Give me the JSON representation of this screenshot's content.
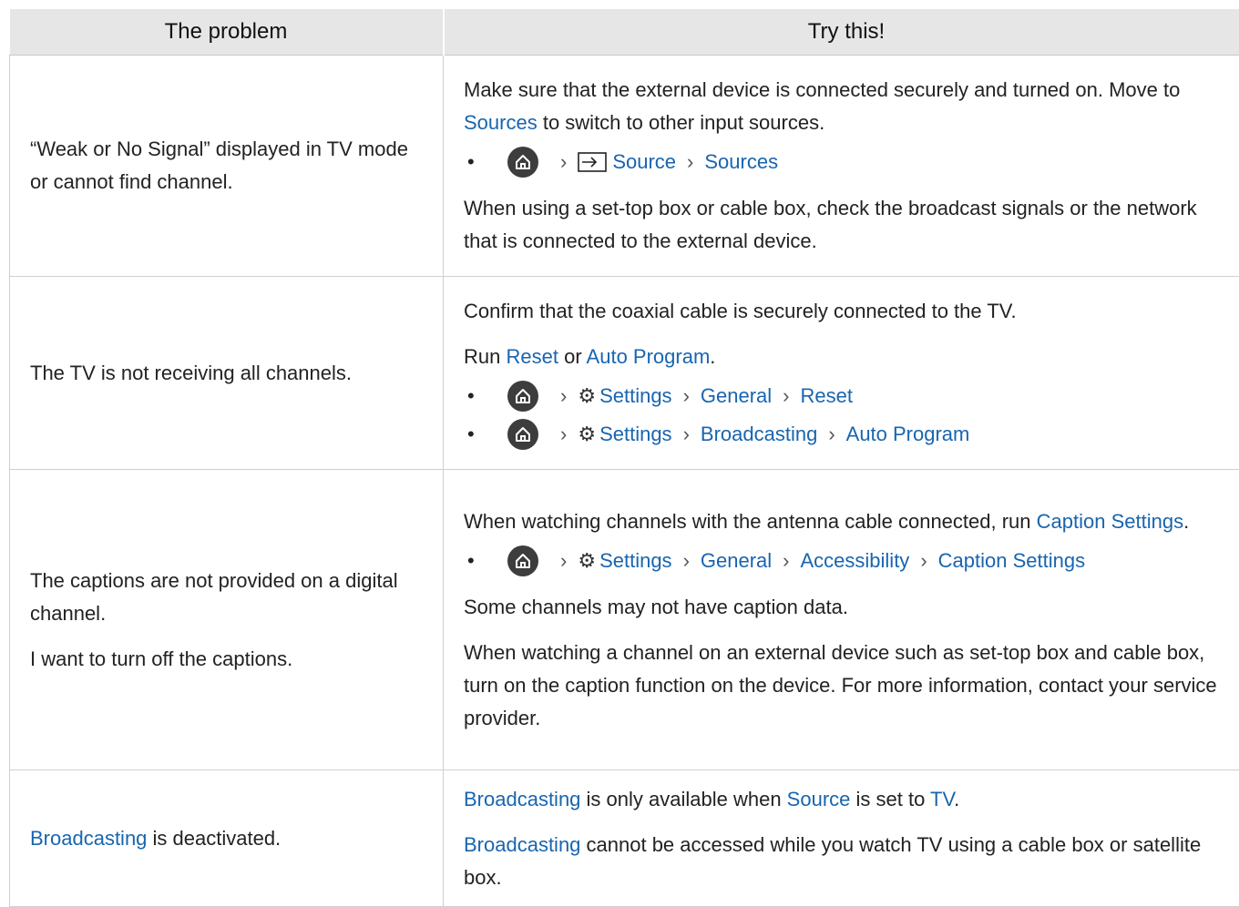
{
  "header": {
    "col1": "The problem",
    "col2": "Try this!"
  },
  "rows": [
    {
      "problem": [
        "“Weak or No Signal” displayed in TV mode or cannot find channel."
      ],
      "p1": {
        "t1": "Make sure that the external device is connected securely and turned on. Move to ",
        "l1": "Sources",
        "t2": " to switch to other input sources."
      },
      "path": [
        "Source",
        "Sources"
      ],
      "p2": "When using a set-top box or cable box, check the broadcast signals or the network that is connected to the external device."
    },
    {
      "problem": [
        "The TV is not receiving all channels."
      ],
      "p1": "Confirm that the coaxial cable is securely connected to the TV.",
      "p2": {
        "t1": "Run ",
        "l1": "Reset",
        "t2": " or ",
        "l2": "Auto Program",
        "t3": "."
      },
      "path1": [
        "Settings",
        "General",
        "Reset"
      ],
      "path2": [
        "Settings",
        "Broadcasting",
        "Auto Program"
      ]
    },
    {
      "problem": [
        "The captions are not provided on a digital channel.",
        "I want to turn off the captions."
      ],
      "p1": {
        "t1": "When watching channels with the antenna cable connected, run ",
        "l1": "Caption Settings",
        "t2": "."
      },
      "path": [
        "Settings",
        "General",
        "Accessibility",
        "Caption Settings"
      ],
      "p2": "Some channels may not have caption data.",
      "p3": "When watching a channel on an external device such as set-top box and cable box, turn on the caption function on the device. For more information, contact your service provider."
    },
    {
      "problem": {
        "l1": "Broadcasting",
        "t1": " is deactivated."
      },
      "p1": {
        "l1": "Broadcasting",
        "t1": " is only available when ",
        "l2": "Source",
        "t2": " is set to ",
        "l3": "TV",
        "t3": "."
      },
      "p2": {
        "l1": "Broadcasting",
        "t1": " cannot be accessed while you watch TV using a cable box or satellite box."
      }
    }
  ],
  "bullet": "•",
  "chevron": "›",
  "colors": {
    "link": "#1865b0",
    "header_bg": "#e6e6e6",
    "home_icon_bg": "#3d3d3d"
  }
}
